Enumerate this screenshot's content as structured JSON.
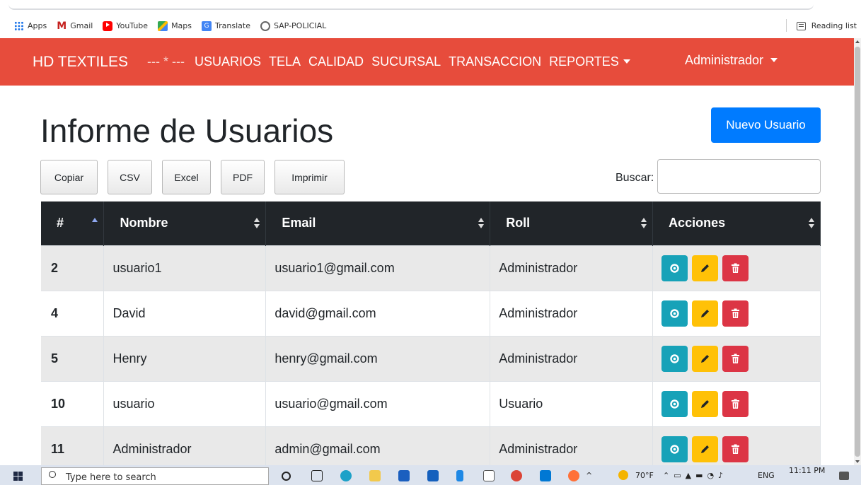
{
  "bookmarks": [
    {
      "label": "Apps",
      "icon": "apps-grid-icon"
    },
    {
      "label": "Gmail",
      "icon": "gmail-icon"
    },
    {
      "label": "YouTube",
      "icon": "youtube-icon"
    },
    {
      "label": "Maps",
      "icon": "maps-icon"
    },
    {
      "label": "Translate",
      "icon": "translate-icon"
    },
    {
      "label": "SAP-POLICIAL",
      "icon": "sap-globe-icon"
    }
  ],
  "reading_list": "Reading list",
  "navbar": {
    "brand": "HD TEXTILES",
    "separator": "--- * ---",
    "links": [
      "USUARIOS",
      "TELA",
      "CALIDAD",
      "SUCURSAL",
      "TRANSACCION"
    ],
    "reports": "REPORTES",
    "user": "Administrador",
    "color": "#e74c3c"
  },
  "page": {
    "title": "Informe de Usuarios",
    "new_button": "Nuevo Usuario",
    "export_buttons": [
      "Copiar",
      "CSV",
      "Excel",
      "PDF",
      "Imprimir"
    ],
    "search_label": "Buscar:",
    "search_value": ""
  },
  "table": {
    "headers": [
      "#",
      "Nombre",
      "Email",
      "Roll",
      "Acciones"
    ],
    "rows": [
      {
        "id": "2",
        "nombre": "usuario1",
        "email": "usuario1@gmail.com",
        "roll": "Administrador"
      },
      {
        "id": "4",
        "nombre": "David",
        "email": "david@gmail.com",
        "roll": "Administrador"
      },
      {
        "id": "5",
        "nombre": "Henry",
        "email": "henry@gmail.com",
        "roll": "Administrador"
      },
      {
        "id": "10",
        "nombre": "usuario",
        "email": "usuario@gmail.com",
        "roll": "Usuario"
      },
      {
        "id": "11",
        "nombre": "Administrador",
        "email": "admin@gmail.com",
        "roll": "Administrador"
      }
    ],
    "action_colors": {
      "view": "#17a2b8",
      "edit": "#ffc107",
      "delete": "#dc3545"
    }
  },
  "taskbar": {
    "search_placeholder": "Type here to search",
    "weather": "70°F",
    "language": "ENG",
    "time": "11:11 PM"
  }
}
